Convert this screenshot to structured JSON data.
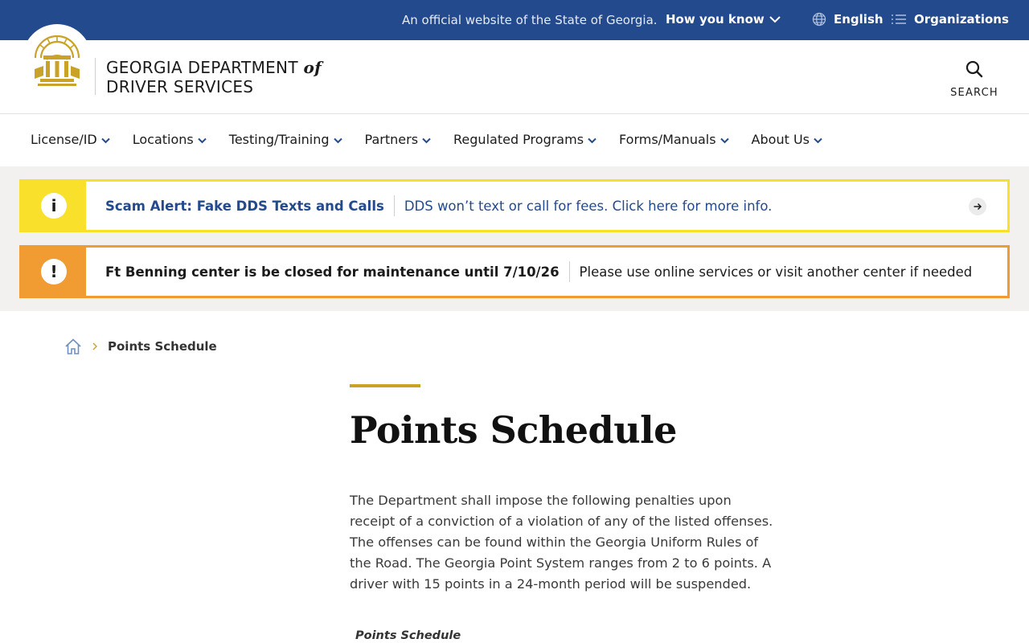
{
  "gov_banner": {
    "official_text": "An official website of the State of Georgia.",
    "how_you_know": "How you know",
    "language": "English",
    "organizations": "Organizations"
  },
  "header": {
    "brand_line1": "GEORGIA DEPARTMENT",
    "brand_of": "of",
    "brand_line2": "DRIVER SERVICES",
    "search_label": "SEARCH"
  },
  "nav": {
    "items": [
      {
        "label": "License/ID"
      },
      {
        "label": "Locations"
      },
      {
        "label": "Testing/Training"
      },
      {
        "label": "Partners"
      },
      {
        "label": "Regulated Programs"
      },
      {
        "label": "Forms/Manuals"
      },
      {
        "label": "About Us"
      }
    ]
  },
  "alerts": [
    {
      "icon": "i",
      "title": "Scam Alert: Fake DDS Texts and Calls",
      "message": "DDS won’t text or call for fees. Click here for more info."
    },
    {
      "icon": "!",
      "title": "Ft Benning center is be closed for maintenance until 7/10/26",
      "message": "Please use online services or visit another center if needed"
    }
  ],
  "breadcrumb": {
    "current": "Points Schedule"
  },
  "main": {
    "title": "Points Schedule",
    "intro": "The Department shall impose the following penalties upon receipt of a conviction of a violation of any of the listed offenses. The offenses can be found within the Georgia Uniform Rules of the Road.  The Georgia Point System ranges from 2 to 6 points. A driver with 15 points in a 24-month period will be suspended.",
    "subheading": "Points Schedule"
  },
  "colors": {
    "banner_blue": "#234a8c",
    "gold": "#c9a227",
    "alert_yellow": "#f8e02b",
    "alert_orange": "#f19b33"
  }
}
